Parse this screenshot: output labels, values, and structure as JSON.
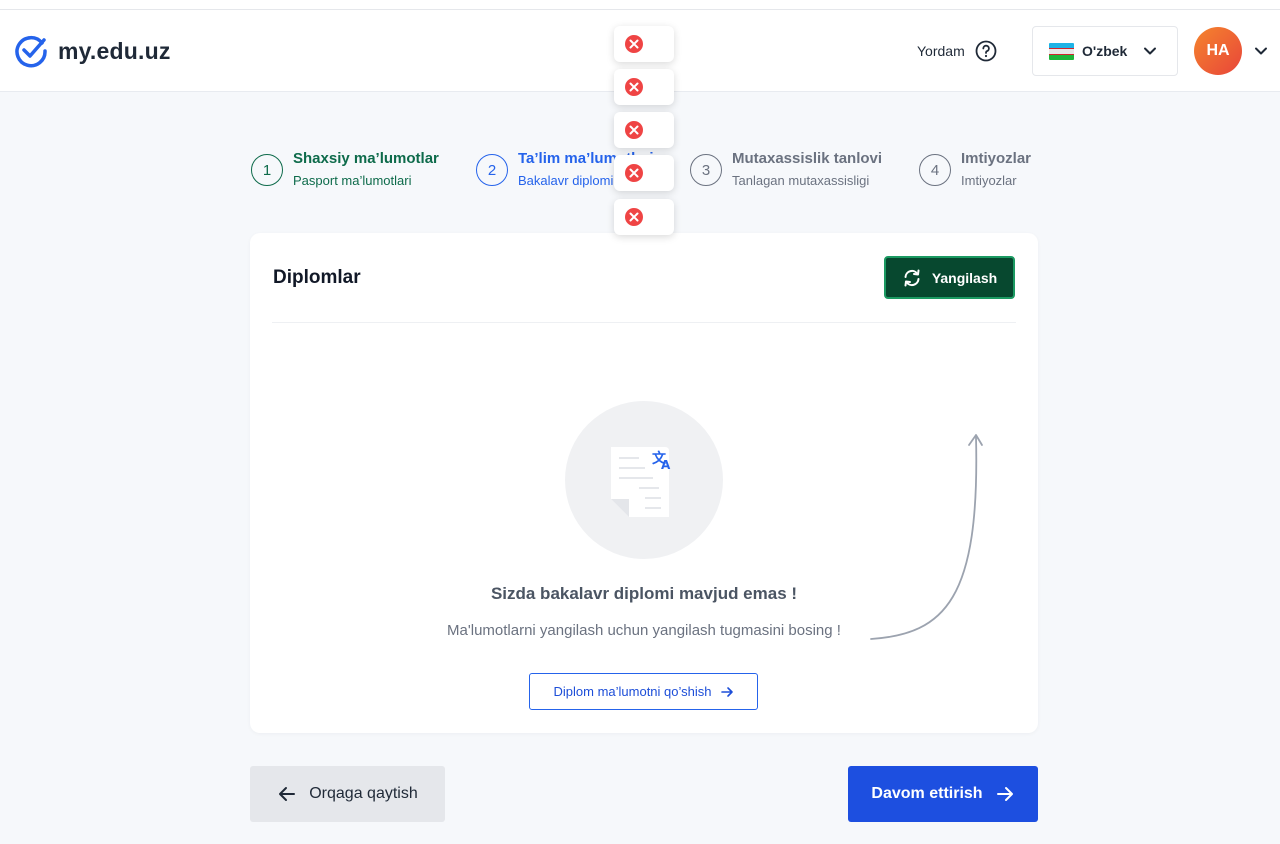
{
  "header": {
    "logo_text": "my.edu.uz",
    "help_label": "Yordam",
    "language": "O'zbek",
    "avatar_initials": "HA"
  },
  "toasts": [
    "error-icon",
    "error-icon",
    "error-icon",
    "error-icon",
    "error-icon"
  ],
  "steps": [
    {
      "number": "1",
      "title": "Shaxsiy ma’lumotlar",
      "subtitle": "Pasport ma’lumotlari",
      "state": "done"
    },
    {
      "number": "2",
      "title": "Ta’lim ma’lumotlari",
      "subtitle": "Bakalavr diplomi",
      "state": "active"
    },
    {
      "number": "3",
      "title": "Mutaxassislik tanlovi",
      "subtitle": "Tanlagan mutaxassisligi",
      "state": "pending"
    },
    {
      "number": "4",
      "title": "Imtiyozlar",
      "subtitle": "Imtiyozlar",
      "state": "pending"
    }
  ],
  "card": {
    "title": "Diplomlar",
    "refresh_label": "Yangilash",
    "empty_title": "Sizda bakalavr diplomi mavjud emas !",
    "empty_subtitle": "Ma'lumotlarni yangilash uchun yangilash tugmasini bosing !",
    "add_label": "Diplom ma’lumotni qo’shish"
  },
  "footer": {
    "back_label": "Orqaga qaytish",
    "next_label": "Davom ettirish"
  },
  "colors": {
    "brand_blue": "#1d4fe0",
    "done_green": "#0e6b4b",
    "refresh_bg": "#07482f",
    "error_red": "#ef4444"
  }
}
